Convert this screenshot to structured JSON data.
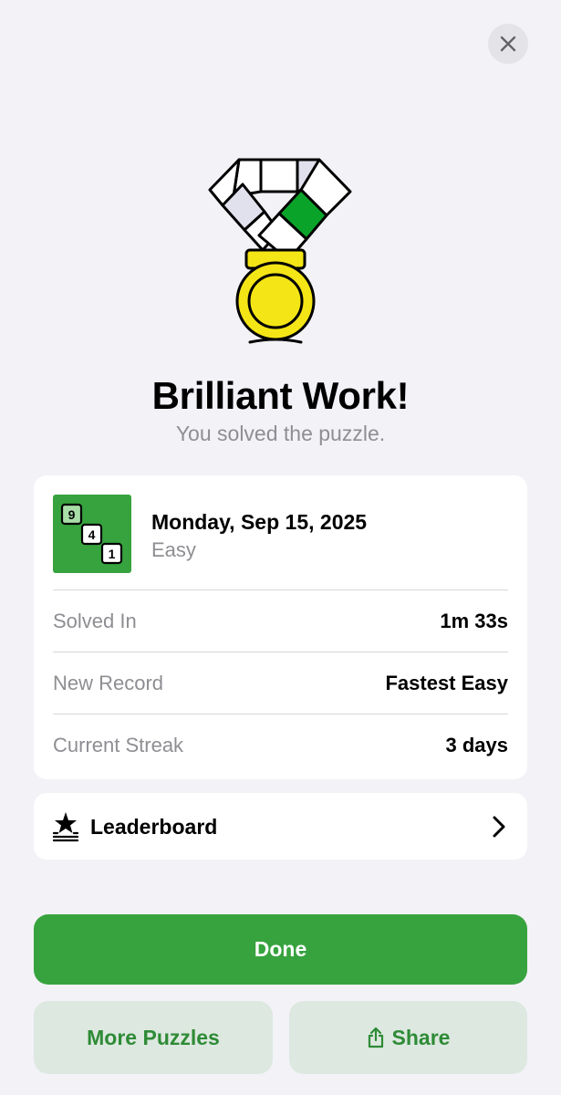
{
  "header": {
    "close_icon": "close-icon"
  },
  "hero": {
    "icon": "medal-icon",
    "colors": {
      "gold": "#f4e516",
      "ribbon_green": "#0aa32a",
      "ribbon_lavender": "#e1e1ee"
    },
    "title": "Brilliant Work!",
    "subtitle": "You solved the puzzle."
  },
  "summary": {
    "thumbnail": {
      "icon": "number-puzzle-icon",
      "digits": [
        "9",
        "4",
        "1"
      ],
      "color": "#37a33e"
    },
    "date": "Monday, Sep 15, 2025",
    "difficulty": "Easy",
    "stats": [
      {
        "label": "Solved In",
        "value": "1m 33s"
      },
      {
        "label": "New Record",
        "value": "Fastest Easy"
      },
      {
        "label": "Current Streak",
        "value": "3 days"
      }
    ]
  },
  "leaderboard": {
    "icon": "leaderboard-icon",
    "label": "Leaderboard",
    "chevron": "chevron-right-icon"
  },
  "actions": {
    "done_label": "Done",
    "more_label": "More Puzzles",
    "share_label": "Share",
    "share_icon": "share-icon",
    "primary_color": "#37a33e",
    "secondary_bg": "#dde8e0",
    "secondary_text": "#2e8b36"
  }
}
